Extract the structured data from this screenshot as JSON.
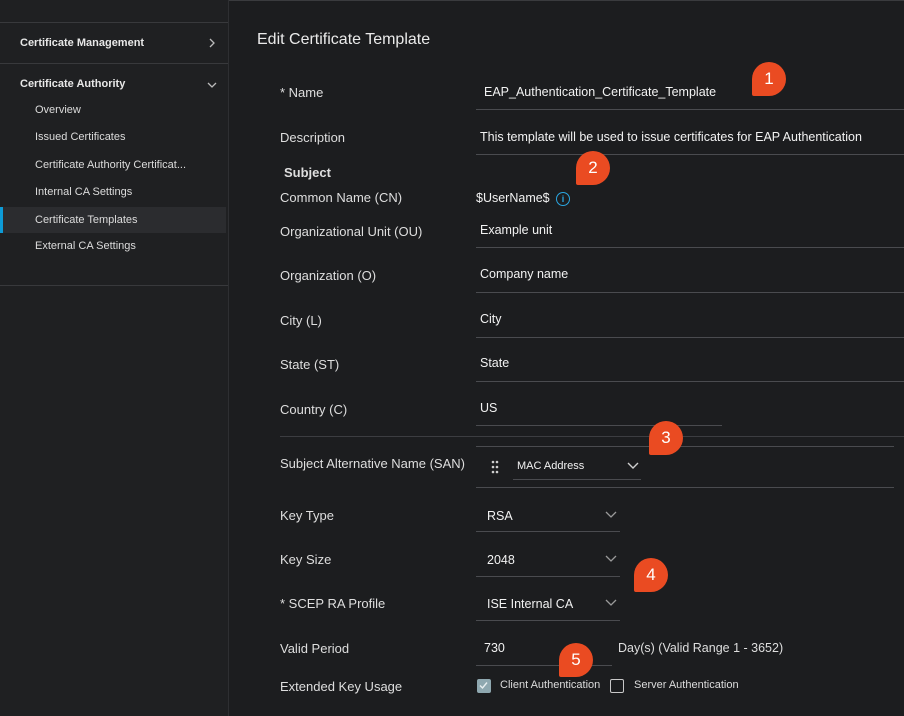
{
  "sidebar": {
    "groups": [
      {
        "label": "Certificate Management",
        "chevron": "chevron-right-icon"
      },
      {
        "label": "Certificate Authority",
        "chevron": "chevron-down-icon"
      }
    ],
    "items": [
      {
        "label": "Overview"
      },
      {
        "label": "Issued Certificates"
      },
      {
        "label": "Certificate Authority Certificat..."
      },
      {
        "label": "Internal CA Settings"
      },
      {
        "label": "Certificate Templates"
      },
      {
        "label": "External CA Settings"
      }
    ],
    "active_item": "Certificate Templates",
    "accent_color": "#0d9bd7"
  },
  "form": {
    "title": "Edit Certificate Template",
    "name": {
      "label": "* Name",
      "value": "EAP_Authentication_Certificate_Template"
    },
    "description": {
      "label": "Description",
      "value": "This template will be used to issue certificates for EAP Authentication"
    },
    "subject_heading": "Subject",
    "cn": {
      "label": "Common Name (CN)",
      "value": "$UserName$",
      "icon": "info-icon"
    },
    "ou": {
      "label": "Organizational Unit (OU)",
      "value": "Example unit"
    },
    "org": {
      "label": "Organization (O)",
      "value": "Company name"
    },
    "city": {
      "label": "City (L)",
      "value": "City"
    },
    "state": {
      "label": "State (ST)",
      "value": "State"
    },
    "country": {
      "label": "Country (C)",
      "value": "US"
    },
    "san": {
      "label": "Subject Alternative Name (SAN)",
      "value": "MAC Address"
    },
    "key_type": {
      "label": "Key Type",
      "value": "RSA"
    },
    "key_size": {
      "label": "Key Size",
      "value": "2048"
    },
    "scep": {
      "label": "* SCEP RA Profile",
      "value": "ISE Internal CA"
    },
    "valid": {
      "label": "Valid Period",
      "value": "730",
      "suffix": "Day(s) (Valid Range 1 - 3652)"
    },
    "eku": {
      "label": "Extended Key Usage",
      "options": [
        {
          "label": "Client Authentication",
          "checked": true
        },
        {
          "label": "Server Authentication",
          "checked": false
        }
      ]
    }
  },
  "badges": [
    "1",
    "2",
    "3",
    "4",
    "5"
  ],
  "badge_color": "#ea4b22"
}
